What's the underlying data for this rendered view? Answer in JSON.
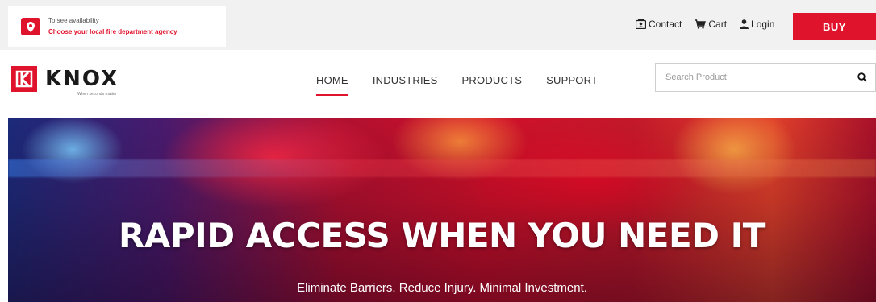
{
  "location": {
    "line1": "To see availability",
    "line2": "Choose your local fire department agency",
    "icon": "map-pin-icon"
  },
  "utility": {
    "contact_label": "Contact",
    "cart_label": "Cart",
    "login_label": "Login",
    "buy_label": "BUY"
  },
  "brand": {
    "name": "KNOX",
    "tagline": "When seconds matter"
  },
  "nav": {
    "items": [
      {
        "label": "HOME",
        "active": true
      },
      {
        "label": "INDUSTRIES",
        "active": false
      },
      {
        "label": "PRODUCTS",
        "active": false
      },
      {
        "label": "SUPPORT",
        "active": false
      }
    ]
  },
  "search": {
    "placeholder": "Search Product",
    "value": ""
  },
  "hero": {
    "title": "RAPID ACCESS WHEN YOU NEED IT",
    "subtitle": "Eliminate Barriers. Reduce Injury. Minimal Investment."
  },
  "colors": {
    "accent": "#e0132c",
    "topbar": "#f1f1f1"
  }
}
